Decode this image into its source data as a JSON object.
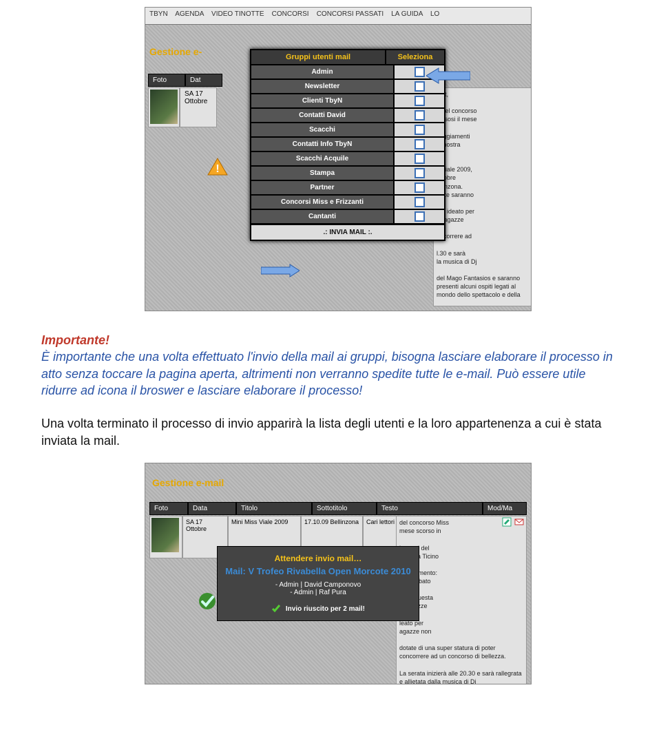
{
  "nav": {
    "items": [
      "TBYN",
      "AGENDA",
      "VIDEO TINOTTE",
      "CONCORSI",
      "CONCORSI PASSATI",
      "LA GUIDA",
      "LO"
    ]
  },
  "section1": {
    "title": "Gestione e-",
    "grid_headers": {
      "foto": "Foto",
      "data": "Dat"
    },
    "row": {
      "date": "SA 17 Ottobre"
    },
    "desc": "ight,\n\no del concorso\nclusosi il mese\n\nceggiamenti\nla nostra\n\no\ns Viale 2009,\nottobre\nellinzona.\nniste saranno\n\nato ideato per\na ragazze\n\noncorrere ad\n\nl.30 e sarà\nla musica di Dj\n\ndel Mago Fantasios e saranno presenti alcuni ospiti legati al mondo dello spettacolo e della"
  },
  "dialog": {
    "head_group": "Gruppi utenti mail",
    "head_select": "Seleziona",
    "rows": [
      "Admin",
      "Newsletter",
      "Clienti TbyN",
      "Contatti David",
      "Scacchi",
      "Contatti Info TbyN",
      "Scacchi Acquile",
      "Stampa",
      "Partner",
      "Concorsi Miss e Frizzanti",
      "Cantanti"
    ],
    "send_label": ".: INVIA MAIL :."
  },
  "doc": {
    "important_title": "Importante!",
    "important_body": "È importante che una volta effettuato l'invio della mail ai gruppi, bisogna lasciare elaborare il processo in atto senza toccare la pagina aperta, altrimenti non verranno spedite tutte le e-mail. Può essere utile ridurre ad icona il broswer e lasciare elaborare il processo!",
    "after": "Una volta terminato il processo di invio apparirà la lista degli utenti e la loro appartenenza a cui è stata inviata la mail."
  },
  "section2": {
    "title": "Gestione e-mail",
    "headers": {
      "foto": "Foto",
      "data": "Data",
      "titolo": "Titolo",
      "sottotitolo": "Sottotitolo",
      "testo": "Testo",
      "mod": "Mod/Ma"
    },
    "row": {
      "date": "SA 17 Ottobre",
      "titolo": "Mini Miss Viale 2009",
      "sott": "17.10.09 Bellinzona",
      "testo": "Cari lettori di Ticino by Night,"
    },
    "desc": "del concorso Miss\nmese scorso in\n\nlamenti del\na rivista Ticino\n\nopuntamento:\nerrà sabato\n\nona. Questa\no bellezze\n\nleato per\nagazze non\n\ndotate di una super statura di poter concorrere ad un concorso di bellezza.\n\nLa serata inizierà alle 20.30 e sarà rallegrata e allietata dalla musica di Dj"
  },
  "status": {
    "title": "Attendere invio mail…",
    "sub": "Mail: V Trofeo Rivabella Open Morcote 2010",
    "list": "- Admin | David Camponovo\n- Admin | Raf Pura",
    "ok": "Invio riuscito per 2 mail!"
  }
}
